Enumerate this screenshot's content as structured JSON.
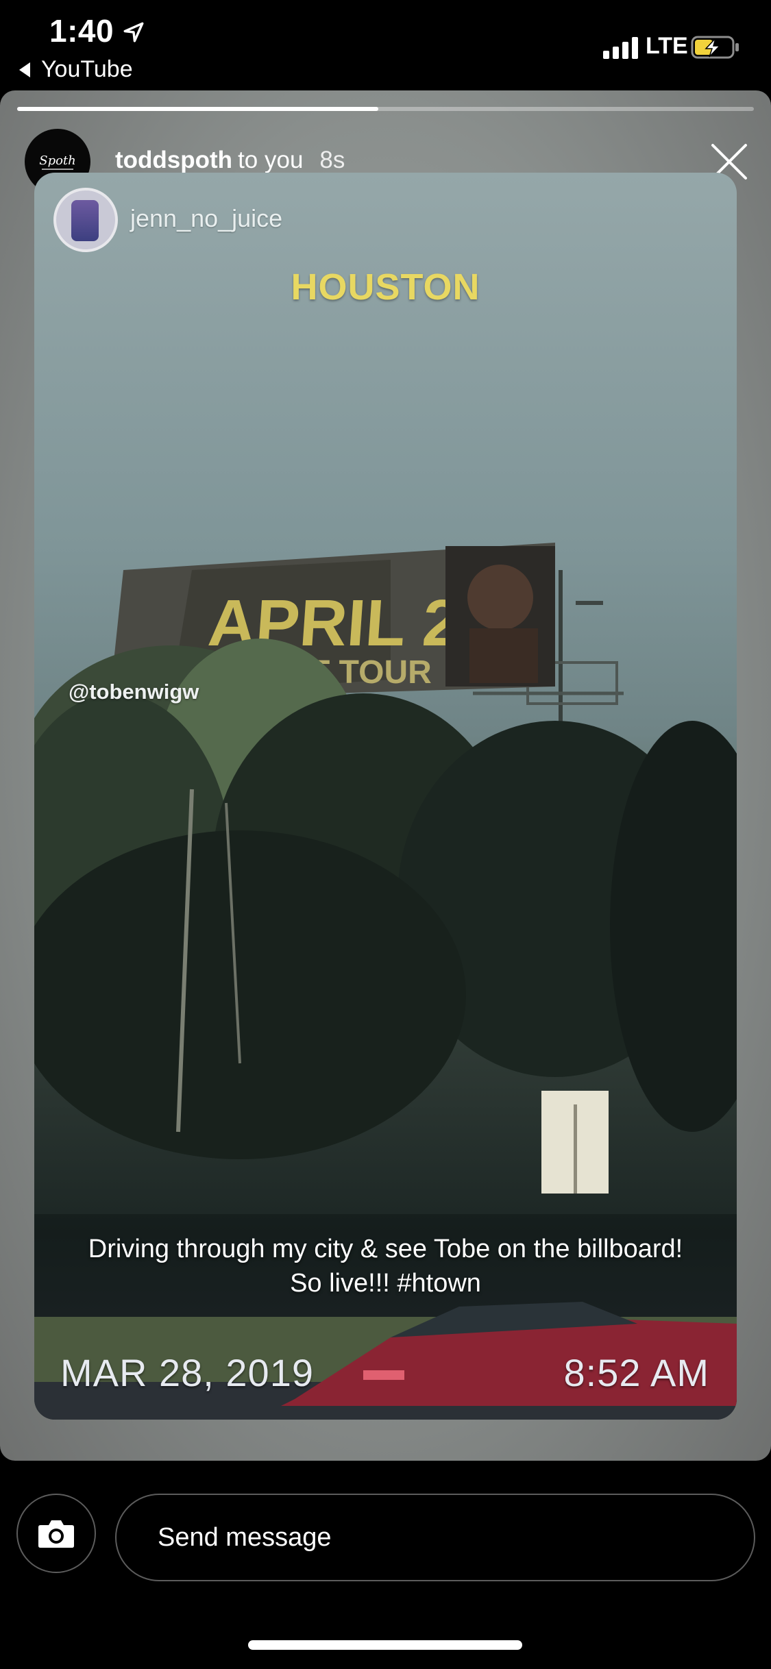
{
  "status_bar": {
    "time": "1:40",
    "back_app": "YouTube",
    "network": "LTE",
    "location_icon": "location-arrow-icon",
    "signal_icon": "cellular-signal-icon",
    "battery_icon": "battery-charging-icon",
    "battery_level": 0.5
  },
  "story": {
    "progress": 0.49,
    "sender": "toddspoth",
    "recipient_label": "to you",
    "age": "8s",
    "avatar_text": "Spoth",
    "close_icon": "close-icon",
    "media": {
      "original_username": "jenn_no_juice",
      "location": "HOUSTON",
      "mention": "@tobenwigw",
      "caption_line1": "Driving through my city & see Tobe on the billboard!",
      "caption_line2": "So live!!! #htown",
      "date": "MAR 28, 2019",
      "time": "8:52 AM"
    }
  },
  "reply": {
    "placeholder": "Send message",
    "camera_icon": "camera-icon"
  }
}
